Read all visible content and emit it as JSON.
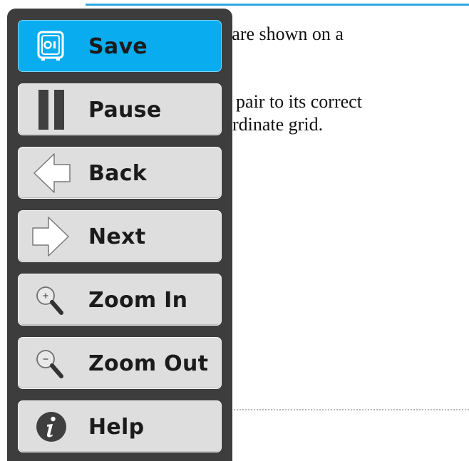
{
  "document": {
    "line1": "rs are shown on a",
    "line2": "ed pair to its correct",
    "line3": "oordinate grid."
  },
  "menu": {
    "items": [
      {
        "label": "Save",
        "icon": "safe-icon",
        "active": true
      },
      {
        "label": "Pause",
        "icon": "pause-icon",
        "active": false
      },
      {
        "label": "Back",
        "icon": "arrow-left-icon",
        "active": false
      },
      {
        "label": "Next",
        "icon": "arrow-right-icon",
        "active": false
      },
      {
        "label": "Zoom In",
        "icon": "zoom-in-icon",
        "active": false
      },
      {
        "label": "Zoom Out",
        "icon": "zoom-out-icon",
        "active": false
      },
      {
        "label": "Help",
        "icon": "info-icon",
        "active": false
      }
    ]
  },
  "colors": {
    "accent": "#0aacf0",
    "panel": "#3d3d3d",
    "button": "#dedede",
    "topline": "#2ea7e0"
  }
}
